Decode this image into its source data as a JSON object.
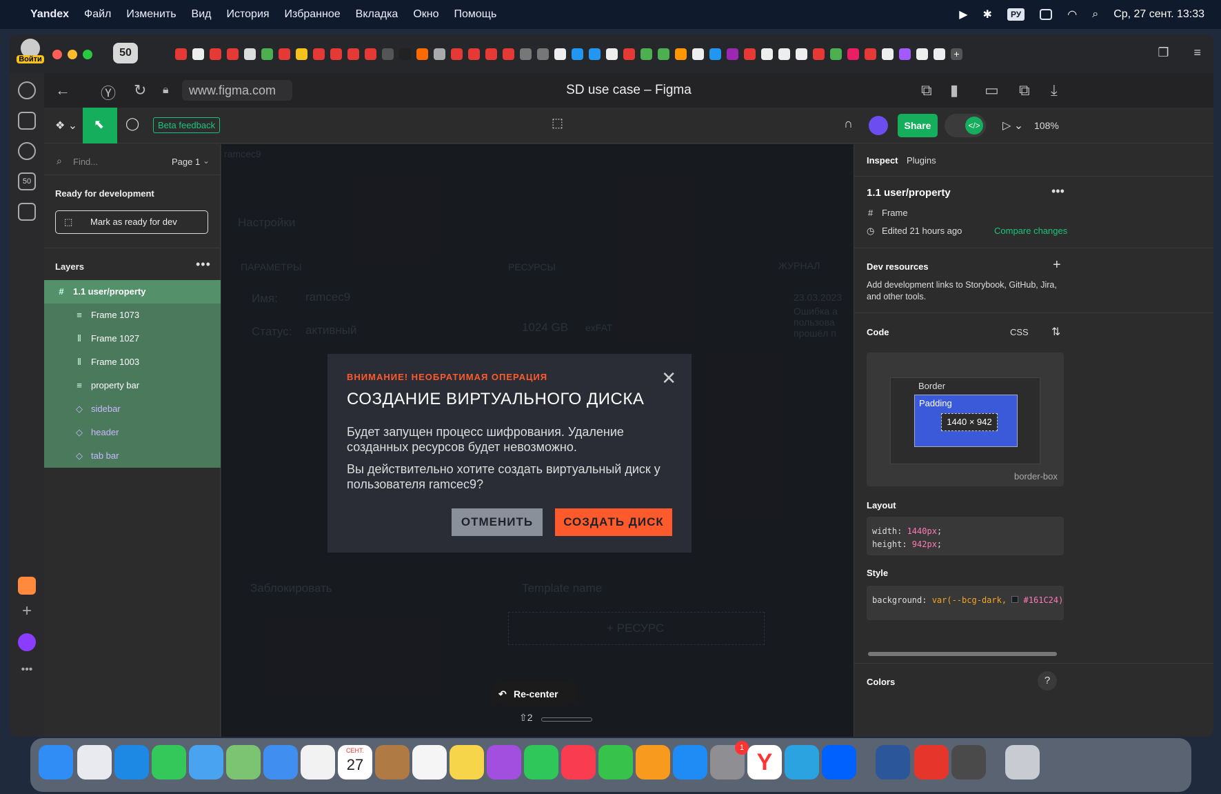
{
  "menubar": {
    "app": "Yandex",
    "items": [
      "Файл",
      "Изменить",
      "Вид",
      "История",
      "Избранное",
      "Вкладка",
      "Окно",
      "Помощь"
    ],
    "lang": "РУ",
    "datetime": "Ср, 27 сент. 13:33"
  },
  "browser": {
    "login_label": "Войти",
    "tab_count": "50",
    "url": "www.figma.com",
    "title": "SD use case – Figma",
    "sidebar_badge": "50"
  },
  "figma_toolbar": {
    "beta_feedback": "Beta feedback",
    "share": "Share",
    "zoom": "108%"
  },
  "layers_panel": {
    "find_placeholder": "Find...",
    "page": "Page 1",
    "ready_title": "Ready for development",
    "mark_ready": "Mark as ready for dev",
    "layers_title": "Layers",
    "root_layer": "1.1 user/property",
    "layers": [
      {
        "name": "Frame 1073",
        "icon": "rows-icon"
      },
      {
        "name": "Frame 1027",
        "icon": "columns-icon"
      },
      {
        "name": "Frame 1003",
        "icon": "columns-icon"
      },
      {
        "name": "property bar",
        "icon": "rows-icon"
      },
      {
        "name": "sidebar",
        "icon": "component-icon"
      },
      {
        "name": "header",
        "icon": "component-icon"
      },
      {
        "name": "tab bar",
        "icon": "component-icon"
      }
    ]
  },
  "canvas": {
    "frame_label": "ramcec9",
    "bg": {
      "settings": "Настройки",
      "params": "ПАРАМЕТРЫ",
      "resources": "РЕСУРСЫ",
      "journal": "ЖУРНАЛ",
      "name_label": "Имя:",
      "name_value": "ramcec9",
      "status_label": "Статус:",
      "status_value": "активный",
      "disk": "1024 GB",
      "fs": "exFAT",
      "date1": "23.03.2023",
      "log1": "Ошибка а пользова прошёл п",
      "block": "Заблокировать",
      "template": "Template name",
      "add_resource": "+ РЕСУРС"
    },
    "modal": {
      "warning": "ВНИМАНИЕ! НЕОБРАТИМАЯ ОПЕРАЦИЯ",
      "title": "СОЗДАНИЕ ВИРТУАЛЬНОГО ДИСКА",
      "p1": "Будет запущен процесс шифрования. Удаление созданных ресурсов будет невозможно.",
      "p2": "Вы действительно хотите создать виртуальный диск у пользователя ramcec9?",
      "cancel": "ОТМЕНИТЬ",
      "confirm": "СОЗДАТЬ ДИСК"
    },
    "recenter": "Re-center",
    "recenter_shortcut": "⇧2"
  },
  "inspect": {
    "tabs": [
      "Inspect",
      "Plugins"
    ],
    "name": "1.1 user/property",
    "type": "Frame",
    "edited": "Edited 21 hours ago",
    "compare": "Compare changes",
    "dev_resources": "Dev resources",
    "dev_desc": "Add development links to Storybook, GitHub, Jira, and other tools.",
    "code": "Code",
    "lang": "CSS",
    "border": "Border",
    "padding": "Padding",
    "size": "1440 × 942",
    "box_sizing": "border-box",
    "layout": "Layout",
    "width_val": "1440px",
    "height_val": "942px",
    "style": "Style",
    "bg_var": "var(--bcg-dark,",
    "bg_hex": "#161C24);",
    "colors": "Colors"
  },
  "dock": {
    "cal_month": "СЕНТ.",
    "cal_day": "27",
    "settings_badge": "1"
  },
  "accent": {
    "figma_green": "#14ae5c",
    "danger": "#ff5a2c"
  }
}
